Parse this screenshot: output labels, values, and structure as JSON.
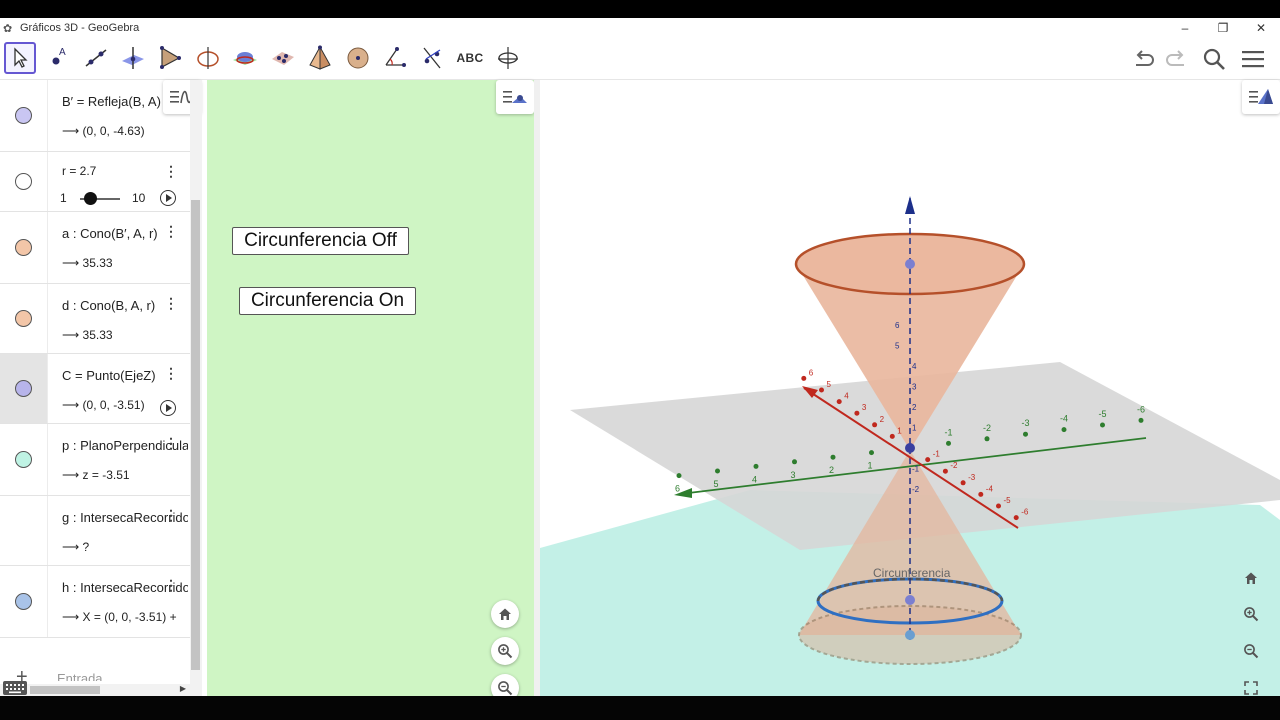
{
  "window": {
    "title": "Gráficos 3D - GeoGebra",
    "minimize": "–",
    "maximize": "❐",
    "close": "✕"
  },
  "toolbar": {
    "tools": [
      "move-tool",
      "point-tool",
      "line-tool",
      "perpendicular-tool",
      "polygon-tool",
      "circle-axis-tool",
      "intersect-surfaces-tool",
      "plane-tool",
      "pyramid-tool",
      "sphere-tool",
      "angle-tool",
      "reflect-tool",
      "text-tool",
      "rotate-view-tool"
    ],
    "text_tool_label": "ABC"
  },
  "algebra": {
    "rows": [
      {
        "def": "B′ = Refleja(B, A)",
        "value": "⟶ (0, 0, -4.63)",
        "color": "#c9c6f2"
      },
      {
        "def": "r = 2.7",
        "slider_min": "1",
        "slider_max": "10",
        "slider_value_fraction": 0.19,
        "color": "#ffffff"
      },
      {
        "def": "a : Cono(B′, A, r)",
        "value": "⟶ 35.33",
        "color": "#f3c6a8"
      },
      {
        "def": "d : Cono(B, A, r)",
        "value": "⟶ 35.33",
        "color": "#f3c6a8"
      },
      {
        "def": "C = Punto(EjeZ)",
        "value": "⟶ (0, 0, -3.51)",
        "color": "#b7b4ea"
      },
      {
        "def": "p : PlanoPerpendicular",
        "value": "⟶ z = -3.51",
        "color": "#bff3e4"
      },
      {
        "def": "g : IntersecaRecorrido",
        "value": "⟶ ?",
        "color": "none"
      },
      {
        "def": "h : IntersecaRecorrido",
        "value": "⟶ X = (0, 0, -3.51) +",
        "color": "#a9c3e8"
      }
    ],
    "input_placeholder": "Entrada..."
  },
  "graphics": {
    "btn_off": "Circunferencia Off",
    "btn_on": "Circunferencia On",
    "background": "#cff5c4"
  },
  "view3d": {
    "label": "Circunferencia",
    "x_ticks": [
      "6",
      "5",
      "4",
      "3",
      "2",
      "1",
      "-1",
      "-2",
      "-3",
      "-4",
      "-5",
      "-6"
    ],
    "y_ticks": [
      "6",
      "5",
      "4",
      "3",
      "2",
      "1",
      "-1",
      "-2",
      "-3",
      "-4",
      "-5",
      "-6"
    ],
    "z_ticks": [
      "6",
      "5",
      "4",
      "3",
      "2",
      "1",
      "-1",
      "-2"
    ],
    "colors": {
      "x_axis": "#c0281e",
      "y_axis": "#2e7d2e",
      "z_axis": "#1c2f8a",
      "cone": "#e9b69c",
      "cone_edge": "#b5502a",
      "circle": "#2f6fc2",
      "plane_bottom": "#b9ece2",
      "plane_middle": "#d9d9d9"
    }
  }
}
